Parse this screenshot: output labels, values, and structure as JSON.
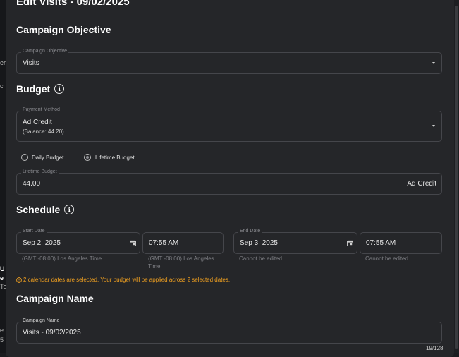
{
  "modal": {
    "title": "Edit Visits - 09/02/2025"
  },
  "background": {
    "fragments": [
      "er",
      "c",
      "U",
      "e",
      "To",
      "e U",
      "5"
    ]
  },
  "objective": {
    "heading": "Campaign Objective",
    "field_label": "Campaign Objective",
    "value": "Visits"
  },
  "budget": {
    "heading": "Budget",
    "payment_label": "Payment Method",
    "payment_value": "Ad Credit",
    "payment_balance": "(Balance: 44.20)",
    "daily_label": "Daily Budget",
    "lifetime_label": "Lifetime Budget",
    "selected": "lifetime",
    "amount_label": "Lifetime Budget",
    "amount_value": "44.00",
    "amount_suffix": "Ad Credit"
  },
  "schedule": {
    "heading": "Schedule",
    "start_label": "Start Date",
    "start_date": "Sep 2, 2025",
    "start_time": "07:55 AM",
    "start_date_helper": "(GMT -08:00) Los Angeles Time",
    "start_time_helper_1": "(GMT -08:00) Los Angeles",
    "start_time_helper_2": "Time",
    "end_label": "End Date",
    "end_date": "Sep 3, 2025",
    "end_time": "07:55 AM",
    "end_date_helper": "Cannot be edited",
    "end_time_helper": "Cannot be edited",
    "warning": "2 calendar dates are selected. Your budget will be applied across 2 selected dates."
  },
  "campaign_name": {
    "heading": "Campaign Name",
    "field_label": "Campaign Name",
    "value": "Visits - 09/02/2025",
    "char_count": "19/128"
  },
  "colors": {
    "warning": "#f0a020",
    "modal_bg": "#252629",
    "border": "#45464b"
  },
  "icons": [
    "info-icon",
    "calendar-icon",
    "dropdown-caret-icon",
    "warning-icon"
  ]
}
